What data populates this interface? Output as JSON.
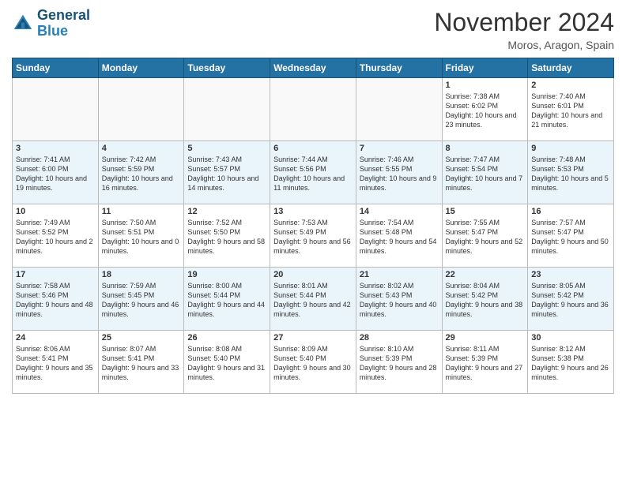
{
  "header": {
    "logo_line1": "General",
    "logo_line2": "Blue",
    "month": "November 2024",
    "location": "Moros, Aragon, Spain"
  },
  "days_of_week": [
    "Sunday",
    "Monday",
    "Tuesday",
    "Wednesday",
    "Thursday",
    "Friday",
    "Saturday"
  ],
  "weeks": [
    [
      {
        "day": "",
        "info": ""
      },
      {
        "day": "",
        "info": ""
      },
      {
        "day": "",
        "info": ""
      },
      {
        "day": "",
        "info": ""
      },
      {
        "day": "",
        "info": ""
      },
      {
        "day": "1",
        "info": "Sunrise: 7:38 AM\nSunset: 6:02 PM\nDaylight: 10 hours and 23 minutes."
      },
      {
        "day": "2",
        "info": "Sunrise: 7:40 AM\nSunset: 6:01 PM\nDaylight: 10 hours and 21 minutes."
      }
    ],
    [
      {
        "day": "3",
        "info": "Sunrise: 7:41 AM\nSunset: 6:00 PM\nDaylight: 10 hours and 19 minutes."
      },
      {
        "day": "4",
        "info": "Sunrise: 7:42 AM\nSunset: 5:59 PM\nDaylight: 10 hours and 16 minutes."
      },
      {
        "day": "5",
        "info": "Sunrise: 7:43 AM\nSunset: 5:57 PM\nDaylight: 10 hours and 14 minutes."
      },
      {
        "day": "6",
        "info": "Sunrise: 7:44 AM\nSunset: 5:56 PM\nDaylight: 10 hours and 11 minutes."
      },
      {
        "day": "7",
        "info": "Sunrise: 7:46 AM\nSunset: 5:55 PM\nDaylight: 10 hours and 9 minutes."
      },
      {
        "day": "8",
        "info": "Sunrise: 7:47 AM\nSunset: 5:54 PM\nDaylight: 10 hours and 7 minutes."
      },
      {
        "day": "9",
        "info": "Sunrise: 7:48 AM\nSunset: 5:53 PM\nDaylight: 10 hours and 5 minutes."
      }
    ],
    [
      {
        "day": "10",
        "info": "Sunrise: 7:49 AM\nSunset: 5:52 PM\nDaylight: 10 hours and 2 minutes."
      },
      {
        "day": "11",
        "info": "Sunrise: 7:50 AM\nSunset: 5:51 PM\nDaylight: 10 hours and 0 minutes."
      },
      {
        "day": "12",
        "info": "Sunrise: 7:52 AM\nSunset: 5:50 PM\nDaylight: 9 hours and 58 minutes."
      },
      {
        "day": "13",
        "info": "Sunrise: 7:53 AM\nSunset: 5:49 PM\nDaylight: 9 hours and 56 minutes."
      },
      {
        "day": "14",
        "info": "Sunrise: 7:54 AM\nSunset: 5:48 PM\nDaylight: 9 hours and 54 minutes."
      },
      {
        "day": "15",
        "info": "Sunrise: 7:55 AM\nSunset: 5:47 PM\nDaylight: 9 hours and 52 minutes."
      },
      {
        "day": "16",
        "info": "Sunrise: 7:57 AM\nSunset: 5:47 PM\nDaylight: 9 hours and 50 minutes."
      }
    ],
    [
      {
        "day": "17",
        "info": "Sunrise: 7:58 AM\nSunset: 5:46 PM\nDaylight: 9 hours and 48 minutes."
      },
      {
        "day": "18",
        "info": "Sunrise: 7:59 AM\nSunset: 5:45 PM\nDaylight: 9 hours and 46 minutes."
      },
      {
        "day": "19",
        "info": "Sunrise: 8:00 AM\nSunset: 5:44 PM\nDaylight: 9 hours and 44 minutes."
      },
      {
        "day": "20",
        "info": "Sunrise: 8:01 AM\nSunset: 5:44 PM\nDaylight: 9 hours and 42 minutes."
      },
      {
        "day": "21",
        "info": "Sunrise: 8:02 AM\nSunset: 5:43 PM\nDaylight: 9 hours and 40 minutes."
      },
      {
        "day": "22",
        "info": "Sunrise: 8:04 AM\nSunset: 5:42 PM\nDaylight: 9 hours and 38 minutes."
      },
      {
        "day": "23",
        "info": "Sunrise: 8:05 AM\nSunset: 5:42 PM\nDaylight: 9 hours and 36 minutes."
      }
    ],
    [
      {
        "day": "24",
        "info": "Sunrise: 8:06 AM\nSunset: 5:41 PM\nDaylight: 9 hours and 35 minutes."
      },
      {
        "day": "25",
        "info": "Sunrise: 8:07 AM\nSunset: 5:41 PM\nDaylight: 9 hours and 33 minutes."
      },
      {
        "day": "26",
        "info": "Sunrise: 8:08 AM\nSunset: 5:40 PM\nDaylight: 9 hours and 31 minutes."
      },
      {
        "day": "27",
        "info": "Sunrise: 8:09 AM\nSunset: 5:40 PM\nDaylight: 9 hours and 30 minutes."
      },
      {
        "day": "28",
        "info": "Sunrise: 8:10 AM\nSunset: 5:39 PM\nDaylight: 9 hours and 28 minutes."
      },
      {
        "day": "29",
        "info": "Sunrise: 8:11 AM\nSunset: 5:39 PM\nDaylight: 9 hours and 27 minutes."
      },
      {
        "day": "30",
        "info": "Sunrise: 8:12 AM\nSunset: 5:38 PM\nDaylight: 9 hours and 26 minutes."
      }
    ]
  ]
}
